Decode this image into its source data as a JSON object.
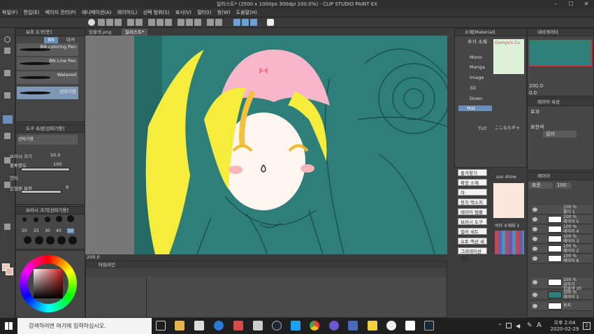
{
  "window": {
    "title": "일러스트* (2500 x 1000px 300dpi 200.0%) - CLIP STUDIO PAINT EX"
  },
  "menu": [
    "파일(F)",
    "편집(E)",
    "페이지 관리(P)",
    "애니메이션(A)",
    "레이어(L)",
    "선택 범위(S)",
    "표시(V)",
    "필터(I)",
    "창(W)",
    "도움말(H)"
  ],
  "left": {
    "subtool_title": "보조 도구[붓]",
    "subtool_tabs": [
      "BN",
      "마커"
    ],
    "brushes": [
      "BN coloring Pen",
      "BN Line Pen",
      "Watered",
      "선따기용"
    ],
    "props_title": "도구 속성[선따기용]",
    "brush_name": "선따기용",
    "props": [
      {
        "label": "브러시 크기",
        "value": "50.0"
      },
      {
        "label": "불투명도",
        "value": "100"
      },
      {
        "label": "안티",
        "value": ""
      },
      {
        "label": "손떨림 보정",
        "value": "9"
      }
    ],
    "size_title": "브러시 크기[선따기용]",
    "sizes": [
      "20",
      "25",
      "30",
      "40",
      "50"
    ],
    "colors": {
      "main": "#f5c9b8",
      "sub": "#e8b7a6"
    }
  },
  "doc_tabs": [
    "임물색.png",
    "일러스트*"
  ],
  "canvas": {
    "zoom": "200.0",
    "bg_color": "#2e7f7a"
  },
  "timeline": {
    "title": "타임라인"
  },
  "material": {
    "header": "소재[Material]",
    "add_label": "추가 소재",
    "tree": [
      "Mono",
      "Manga",
      "Image",
      "3D",
      "Down",
      "Mat",
      "TUT"
    ],
    "preview_labels": [
      "Gomyo's Cu",
      "ここなたギャ",
      "sun shine",
      "여러 수재화 2"
    ],
    "buttons": [
      "즐겨찾기",
      "확장 소재",
      "자",
      "용지 텍스처",
      "레이어 템플릿",
      "브러시 도구",
      "컬러 세트",
      "오토 액션 세트",
      "그라데이션 세트"
    ]
  },
  "navigator": {
    "header": "내비게이터",
    "zoom": "200.0",
    "angle": "0.0"
  },
  "layer_props": {
    "header": "레이어 속성",
    "effect": "효과",
    "expression": "표현색",
    "color_mode": "컬러"
  },
  "layers": {
    "header": "레이어",
    "blend": "표준",
    "opacity": "100",
    "rows": [
      {
        "pct": "100 %",
        "blend": "표준",
        "name": "폴더 1"
      },
      {
        "pct": "100 %",
        "blend": "표준",
        "name": "레이어 5"
      },
      {
        "pct": "100 %",
        "blend": "표준",
        "name": "레이어 4"
      },
      {
        "pct": "100 %",
        "blend": "표준",
        "name": "레이어 3"
      },
      {
        "pct": "100 %",
        "blend": "표준",
        "name": "레이어 2"
      },
      {
        "pct": "100 %",
        "blend": "표준",
        "name": "레이어 6"
      },
      {
        "pct": "100 %",
        "blend": "곱하기",
        "name": "임물색 20"
      },
      {
        "pct": "100 %",
        "blend": "표준",
        "name": "레이어 1"
      },
      {
        "pct": "",
        "blend": "",
        "name": "용지"
      }
    ]
  },
  "taskbar": {
    "search_placeholder": "검색하려면 여기에 입력하십시오.",
    "time": "오후 2:04",
    "date": "2020-02-29",
    "lang": "A",
    "notif_count": "2"
  }
}
